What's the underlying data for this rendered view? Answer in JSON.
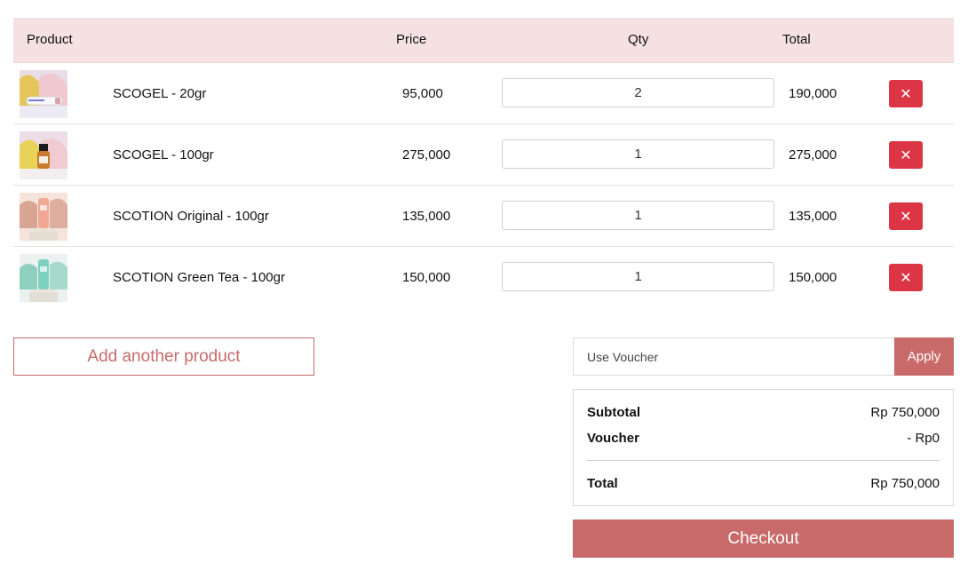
{
  "table": {
    "headers": {
      "product": "Product",
      "price": "Price",
      "qty": "Qty",
      "total": "Total"
    },
    "rows": [
      {
        "name": "SCOGEL - 20gr",
        "price": "95,000",
        "qty": "2",
        "total": "190,000",
        "remove": "✕"
      },
      {
        "name": "SCOGEL - 100gr",
        "price": "275,000",
        "qty": "1",
        "total": "275,000",
        "remove": "✕"
      },
      {
        "name": "SCOTION Original - 100gr",
        "price": "135,000",
        "qty": "1",
        "total": "135,000",
        "remove": "✕"
      },
      {
        "name": "SCOTION Green Tea - 100gr",
        "price": "150,000",
        "qty": "1",
        "total": "150,000",
        "remove": "✕"
      }
    ]
  },
  "actions": {
    "add_product": "Add another product"
  },
  "voucher": {
    "placeholder": "Use Voucher",
    "value": "",
    "apply": "Apply"
  },
  "summary": {
    "subtotal_label": "Subtotal",
    "subtotal_value": "Rp 750,000",
    "voucher_label": "Voucher",
    "voucher_value": "- Rp0",
    "total_label": "Total",
    "total_value": "Rp 750,000"
  },
  "checkout": {
    "label": "Checkout"
  },
  "colors": {
    "accent": "#c86a6a",
    "header_bg": "#f5e1e1",
    "remove": "#dc3545"
  }
}
